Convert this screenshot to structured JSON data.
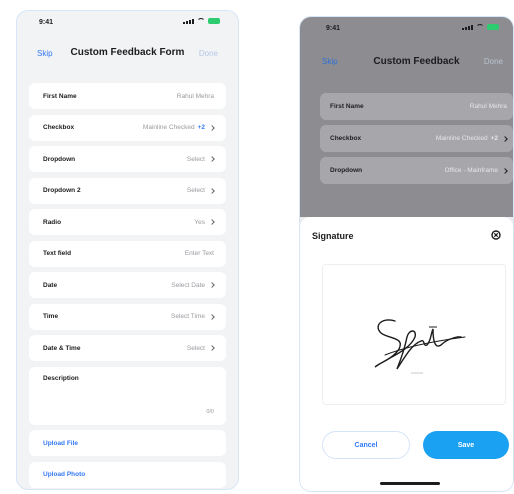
{
  "left_screen": {
    "status_time": "9:41",
    "nav": {
      "left": "Skip",
      "title": "Custom Feedback Form",
      "right": "Done"
    },
    "rows": [
      {
        "label": "First Name",
        "value": "Rahul Mehra",
        "chevron": false,
        "plus": ""
      },
      {
        "label": "Checkbox",
        "value": "Mainline Checked",
        "chevron": true,
        "plus": "+2"
      },
      {
        "label": "Dropdown",
        "value": "Select",
        "chevron": true,
        "plus": ""
      },
      {
        "label": "Dropdown 2",
        "value": "Select",
        "chevron": true,
        "plus": ""
      },
      {
        "label": "Radio",
        "value": "Yes",
        "chevron": true,
        "plus": ""
      },
      {
        "label": "Text field",
        "value": "Enter Text",
        "chevron": false,
        "plus": ""
      },
      {
        "label": "Date",
        "value": "Select Date",
        "chevron": true,
        "plus": ""
      },
      {
        "label": "Time",
        "value": "Select Time",
        "chevron": true,
        "plus": ""
      },
      {
        "label": "Date & Time",
        "value": "Select",
        "chevron": true,
        "plus": ""
      }
    ],
    "description": {
      "label": "Description",
      "count": "0/0"
    },
    "links": [
      "Upload File",
      "Upload Photo"
    ]
  },
  "right_screen": {
    "status_time": "9:41",
    "nav": {
      "left": "Skip",
      "title": "Custom Feedback",
      "right": "Done"
    },
    "rows": [
      {
        "label": "First Name",
        "value": "Rahul Mehra",
        "chevron": false,
        "plus": ""
      },
      {
        "label": "Checkbox",
        "value": "Mainline Checked",
        "chevron": true,
        "plus": "+2"
      },
      {
        "label": "Dropdown",
        "value": "Office - Mainframe",
        "chevron": true,
        "plus": ""
      }
    ],
    "sheet": {
      "title": "Signature",
      "cancel": "Cancel",
      "save": "Save"
    }
  },
  "colors": {
    "accent": "#3478f6",
    "save_button": "#1ba1f2",
    "battery": "#2ecc71",
    "frame_border": "#d6e6f7"
  }
}
